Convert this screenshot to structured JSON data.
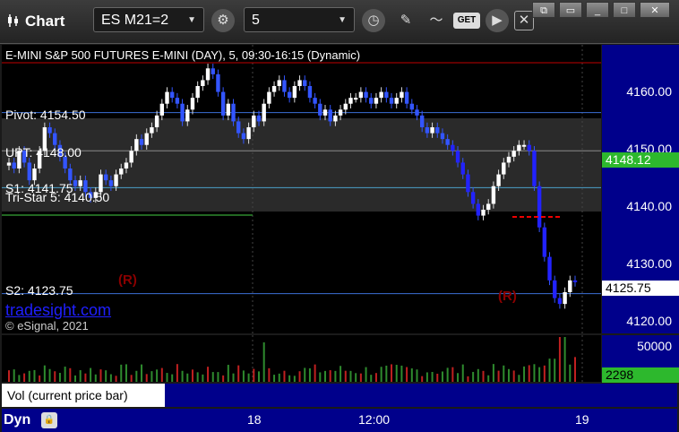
{
  "toolbar": {
    "app_title": "Chart",
    "symbol": "ES M21=2",
    "interval": "5",
    "buttons": [
      "settings-icon",
      "clock-icon",
      "pencil-icon",
      "study-icon",
      "get-icon",
      "play-icon",
      "close-icon"
    ],
    "window_controls": [
      "restore-icon",
      "tile-icon",
      "minimize-icon",
      "maximize-icon",
      "close-icon"
    ]
  },
  "chart": {
    "header": "E-MINI S&P 500 FUTURES E-MINI (DAY), 5, 09:30-16:15 (Dynamic)",
    "levels": [
      {
        "name": "pivot",
        "label": "Pivot: 4154.50",
        "value": 4154.5,
        "color": "#3b6fd4"
      },
      {
        "name": "upt",
        "label": "UPT: 4148.00",
        "value": 4148.0,
        "color": "#8a8a8a"
      },
      {
        "name": "s1",
        "label": "S1: 4141.75",
        "value": 4141.75,
        "color": "#4aa0c8"
      },
      {
        "name": "tri-star",
        "label": "Tri-Star 5: 4140.50",
        "value": 4140.5,
        "color": "#2e8b2e"
      },
      {
        "name": "s2",
        "label": "S2: 4123.75",
        "value": 4123.75,
        "color": "#3b6fd4"
      }
    ],
    "r_marks": [
      "(R)",
      "(R)"
    ],
    "watermark": "tradesight.com",
    "copyright": "© eSignal, 2021",
    "y_axis": {
      "ticks": [
        "4160.00",
        "4150.00",
        "4140.00",
        "4130.00",
        "4120.00"
      ],
      "min": 4117,
      "max": 4166
    },
    "price_tags": [
      {
        "text": "4148.12",
        "bg": "#2db82d",
        "fg": "#ffffff",
        "value": 4148.12
      },
      {
        "text": "4125.75",
        "bg": "#ffffff",
        "fg": "#000000",
        "value": 4125.75
      }
    ]
  },
  "volume": {
    "label": "Vol (current price bar)",
    "close": "x",
    "axis_tick": "50000",
    "current": "2298",
    "current_bg": "#2db82d"
  },
  "time_axis": {
    "labels": [
      "18",
      "12:00",
      "19"
    ],
    "dyn": "Dyn",
    "dyn_icon": "lock-icon"
  },
  "chart_data": {
    "type": "candlestick",
    "title": "E-MINI S&P 500 FUTURES E-MINI (DAY), 5, 09:30-16:15 (Dynamic)",
    "ylim": [
      4117,
      4166
    ],
    "closes": [
      4146,
      4145,
      4148,
      4146,
      4143,
      4145,
      4148,
      4152,
      4151,
      4149,
      4147,
      4145,
      4143,
      4142,
      4143,
      4141,
      4140,
      4141,
      4144,
      4143,
      4142,
      4144,
      4145,
      4146,
      4148,
      4150,
      4149,
      4151,
      4152,
      4154,
      4156,
      4158,
      4157,
      4156,
      4153,
      4155,
      4157,
      4159,
      4160,
      4162,
      4161,
      4158,
      4154,
      4156,
      4153,
      4151,
      4150,
      4152,
      4154,
      4153,
      4156,
      4158,
      4159,
      4160,
      4158,
      4157,
      4159,
      4160,
      4159,
      4157,
      4156,
      4154,
      4155,
      4153,
      4154,
      4155,
      4156,
      4157,
      4157,
      4158,
      4157,
      4156,
      4157,
      4158,
      4157,
      4156,
      4157,
      4158,
      4156,
      4155,
      4154,
      4152,
      4151,
      4152,
      4151,
      4150,
      4149,
      4148,
      4146,
      4144,
      4141,
      4139,
      4137,
      4138,
      4139,
      4142,
      4144,
      4146,
      4147,
      4148,
      4149,
      4149,
      4148,
      4142,
      4135,
      4130,
      4126,
      4123,
      4122,
      4124,
      4126,
      4125.75
    ]
  }
}
